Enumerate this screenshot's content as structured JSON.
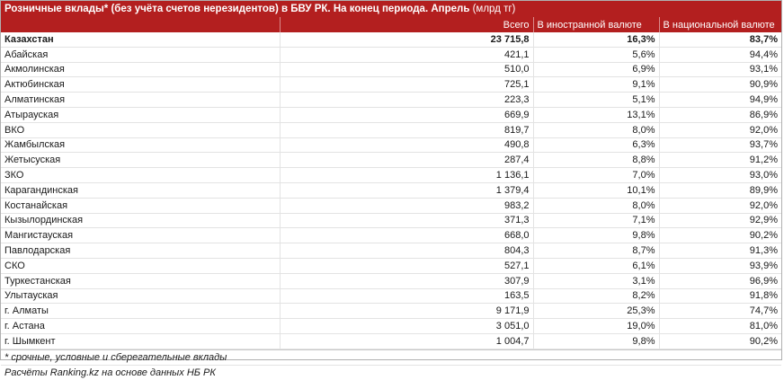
{
  "title": {
    "main": "Розничные вклады* (без учёта счетов нерезидентов) в БВУ РК. На конец периода. Апрель",
    "unit": "(млрд тг)"
  },
  "columns": [
    "",
    "Всего",
    "В иностранной валюте",
    "В национальной валюте"
  ],
  "rows": [
    [
      "Казахстан",
      "23 715,8",
      "16,3%",
      "83,7%"
    ],
    [
      "Абайская",
      "421,1",
      "5,6%",
      "94,4%"
    ],
    [
      "Акмолинская",
      "510,0",
      "6,9%",
      "93,1%"
    ],
    [
      "Актюбинская",
      "725,1",
      "9,1%",
      "90,9%"
    ],
    [
      "Алматинская",
      "223,3",
      "5,1%",
      "94,9%"
    ],
    [
      "Атырауская",
      "669,9",
      "13,1%",
      "86,9%"
    ],
    [
      "ВКО",
      "819,7",
      "8,0%",
      "92,0%"
    ],
    [
      "Жамбылская",
      "490,8",
      "6,3%",
      "93,7%"
    ],
    [
      "Жетысуская",
      "287,4",
      "8,8%",
      "91,2%"
    ],
    [
      "ЗКО",
      "1 136,1",
      "7,0%",
      "93,0%"
    ],
    [
      "Карагандинская",
      "1 379,4",
      "10,1%",
      "89,9%"
    ],
    [
      "Костанайская",
      "983,2",
      "8,0%",
      "92,0%"
    ],
    [
      "Кызылординская",
      "371,3",
      "7,1%",
      "92,9%"
    ],
    [
      "Мангистауская",
      "668,0",
      "9,8%",
      "90,2%"
    ],
    [
      "Павлодарская",
      "804,3",
      "8,7%",
      "91,3%"
    ],
    [
      "СКО",
      "527,1",
      "6,1%",
      "93,9%"
    ],
    [
      "Туркестанская",
      "307,9",
      "3,1%",
      "96,9%"
    ],
    [
      "Улытауская",
      "163,5",
      "8,2%",
      "91,8%"
    ],
    [
      "г. Алматы",
      "9 171,9",
      "25,3%",
      "74,7%"
    ],
    [
      "г. Астана",
      "3 051,0",
      "19,0%",
      "81,0%"
    ],
    [
      "г. Шымкент",
      "1 004,7",
      "9,8%",
      "90,2%"
    ]
  ],
  "footnotes": {
    "note": "* срочные, условные и сберегательные вклады",
    "source": "Расчёты Ranking.kz на основе данных НБ РК"
  },
  "colors": {
    "header_bg": "#b31f1f",
    "header_text": "#ffffff"
  }
}
